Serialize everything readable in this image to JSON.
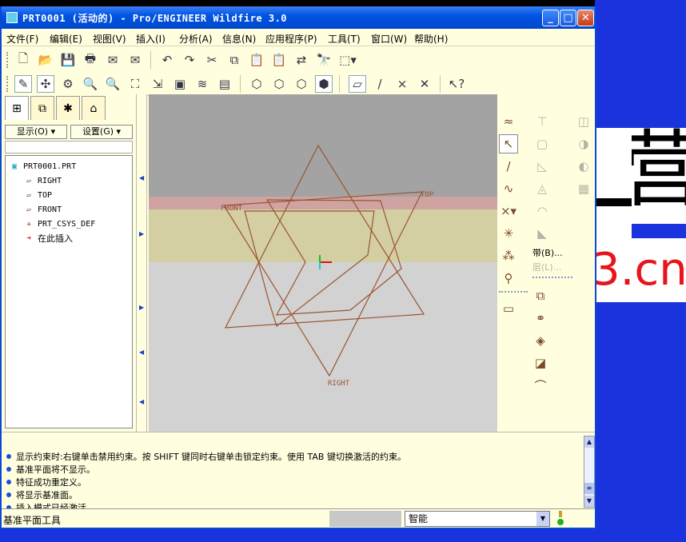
{
  "window": {
    "title": "PRT0001 (活动的) - Pro/ENGINEER Wildfire 3.0",
    "controls": {
      "minimize": "_",
      "maximize": "□",
      "close": "✕"
    }
  },
  "desktop": {
    "glyph": "营",
    "text": "3.cn",
    "colors": {
      "background": "#1a33dd",
      "text": "#e8141b"
    }
  },
  "menubar": {
    "items": [
      "文件(F)",
      "编辑(E)",
      "视图(V)",
      "插入(I)",
      "分析(A)",
      "信息(N)",
      "应用程序(P)",
      "工具(T)",
      "窗口(W)",
      "帮助(H)"
    ]
  },
  "navigator": {
    "show_dropdown": "显示(O) ▾",
    "settings_dropdown": "设置(G) ▾",
    "tree": [
      {
        "label": "PRT0001.PRT",
        "icon": "part-icon"
      },
      {
        "label": "RIGHT",
        "icon": "datum-plane-icon"
      },
      {
        "label": "TOP",
        "icon": "datum-plane-icon"
      },
      {
        "label": "FRONT",
        "icon": "datum-plane-icon"
      },
      {
        "label": "PRT_CSYS_DEF",
        "icon": "csys-icon"
      },
      {
        "label": "在此插入",
        "icon": "insert-arrow-icon"
      }
    ]
  },
  "graphics": {
    "datum_labels": {
      "front": "FRONT",
      "top": "TOP",
      "right": "RIGHT"
    },
    "colors": {
      "plane": "#9a5530",
      "background": "#d2d2d2"
    }
  },
  "right_toolbar": {
    "band_label": "带(B)...",
    "layer_label": "层(L)..."
  },
  "messages": [
    "显示约束时:右键单击禁用约束。按 SHIFT 键同时右键单击锁定约束。使用 TAB 键切换激活的约束。",
    "基准平面将不显示。",
    "特征成功重定义。",
    "将显示基准面。",
    "插入模式已经激活。"
  ],
  "status": {
    "text": "基准平面工具",
    "filter": "智能"
  }
}
